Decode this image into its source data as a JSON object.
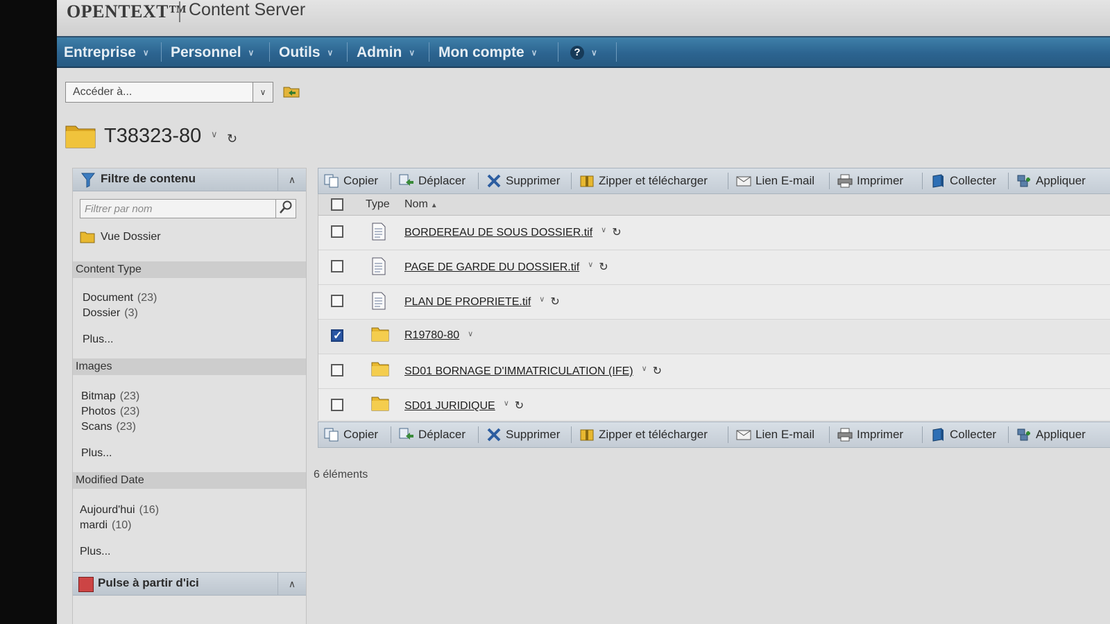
{
  "header": {
    "brand": "OPENTEXT™",
    "product": "Content Server"
  },
  "menu": {
    "items": [
      {
        "label": "Entreprise"
      },
      {
        "label": "Personnel"
      },
      {
        "label": "Outils"
      },
      {
        "label": "Admin"
      },
      {
        "label": "Mon compte"
      }
    ],
    "help_glyph": "?"
  },
  "goto": {
    "placeholder": "Accéder à..."
  },
  "page": {
    "title": "T38323-80"
  },
  "filter": {
    "title": "Filtre de contenu",
    "search_placeholder": "Filtrer par nom",
    "folder_view_label": "Vue Dossier",
    "sections": [
      {
        "title": "Content Type",
        "items": [
          {
            "label": "Document",
            "count": "(23)"
          },
          {
            "label": "Dossier",
            "count": "(3)"
          }
        ],
        "more": "Plus..."
      },
      {
        "title": "Images",
        "items": [
          {
            "label": "Bitmap",
            "count": "(23)"
          },
          {
            "label": "Photos",
            "count": "(23)"
          },
          {
            "label": "Scans",
            "count": "(23)"
          }
        ],
        "more": "Plus..."
      },
      {
        "title": "Modified Date",
        "items": [
          {
            "label": "Aujourd'hui",
            "count": "(16)"
          },
          {
            "label": "mardi",
            "count": "(10)"
          }
        ],
        "more": "Plus..."
      }
    ],
    "pulse_title": "Pulse à partir d'ici"
  },
  "toolbar": {
    "copy": "Copier",
    "move": "Déplacer",
    "delete": "Supprimer",
    "zip": "Zipper et télécharger",
    "email": "Lien E-mail",
    "print": "Imprimer",
    "collect": "Collecter",
    "apply": "Appliquer"
  },
  "list": {
    "col_type": "Type",
    "col_name": "Nom",
    "rows": [
      {
        "name": "BORDEREAU DE SOUS DOSSIER.tif",
        "type": "document",
        "checked": false
      },
      {
        "name": "PAGE DE GARDE DU DOSSIER.tif",
        "type": "document",
        "checked": false
      },
      {
        "name": "PLAN DE PROPRIETE.tif",
        "type": "document",
        "checked": false
      },
      {
        "name": "R19780-80",
        "type": "folder",
        "checked": true
      },
      {
        "name": "SD01 BORNAGE D'IMMATRICULATION (IFE)",
        "type": "folder",
        "checked": false
      },
      {
        "name": "SD01 JURIDIQUE",
        "type": "folder",
        "checked": false
      }
    ],
    "count_text": "6 éléments"
  },
  "colors": {
    "menubar": "#2c6490",
    "selected_checkbox": "#2a56a4",
    "folder": "#e8b830"
  }
}
